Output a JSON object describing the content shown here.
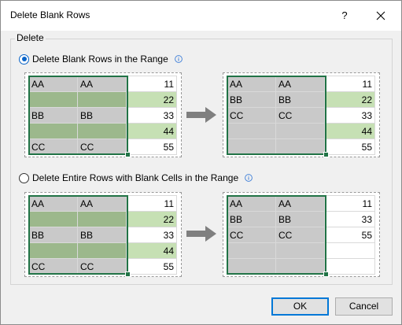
{
  "window": {
    "title": "Delete Blank Rows",
    "help_label": "?"
  },
  "group": {
    "label": "Delete"
  },
  "options": [
    {
      "label": "Delete Blank Rows in the Range",
      "checked": true
    },
    {
      "label": "Delete Entire Rows with Blank Cells in the Range",
      "checked": false
    }
  ],
  "diagrams": {
    "blank_before": [
      [
        "AA",
        "AA",
        "11"
      ],
      [
        "",
        "",
        "22"
      ],
      [
        "BB",
        "BB",
        "33"
      ],
      [
        "",
        "",
        "44"
      ],
      [
        "CC",
        "CC",
        "55"
      ]
    ],
    "blank_after": [
      [
        "AA",
        "AA",
        "11"
      ],
      [
        "BB",
        "BB",
        "22"
      ],
      [
        "CC",
        "CC",
        "33"
      ],
      [
        "",
        "",
        "44"
      ],
      [
        "",
        "",
        "55"
      ]
    ],
    "entire_before": [
      [
        "AA",
        "AA",
        "11"
      ],
      [
        "",
        "",
        "22"
      ],
      [
        "BB",
        "BB",
        "33"
      ],
      [
        "",
        "",
        "44"
      ],
      [
        "CC",
        "CC",
        "55"
      ]
    ],
    "entire_after": [
      [
        "AA",
        "AA",
        "11"
      ],
      [
        "BB",
        "BB",
        "33"
      ],
      [
        "CC",
        "CC",
        "55"
      ],
      [
        "",
        "",
        ""
      ],
      [
        "",
        "",
        ""
      ]
    ]
  },
  "buttons": {
    "ok": "OK",
    "cancel": "Cancel"
  },
  "colors": {
    "accent": "#0078d7",
    "selection": "#217346",
    "dark_green": "#9cb88c",
    "light_green": "#c6e0b4",
    "gray": "#c9c9c9"
  }
}
